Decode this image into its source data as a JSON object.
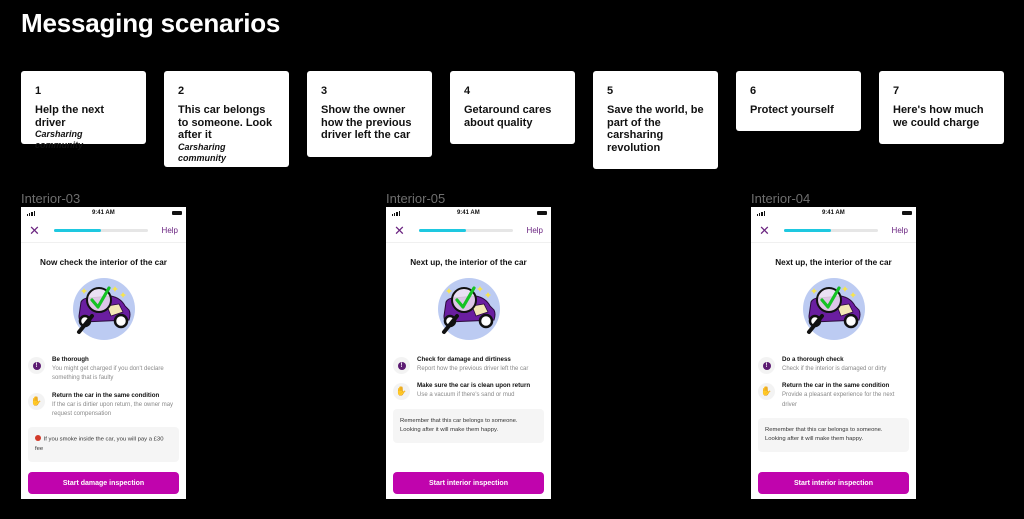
{
  "page": {
    "title": "Messaging scenarios"
  },
  "colors": {
    "background": "#000000",
    "brand_purple": "#6b2480",
    "cta_magenta": "#c004ad",
    "progress_fill": "#1ec8e0"
  },
  "scenarios": [
    {
      "number": "1",
      "text": "Help the next driver",
      "subtitle": "Carsharing community"
    },
    {
      "number": "2",
      "text": "This car belongs to someone. Look after it",
      "subtitle": "Carsharing community"
    },
    {
      "number": "3",
      "text": "Show the owner how the previous driver left the car",
      "subtitle": ""
    },
    {
      "number": "4",
      "text": "Getaround cares about quality",
      "subtitle": ""
    },
    {
      "number": "5",
      "text": "Save the world, be part of the carsharing revolution",
      "subtitle": ""
    },
    {
      "number": "6",
      "text": "Protect yourself",
      "subtitle": ""
    },
    {
      "number": "7",
      "text": "Here's how much we could charge",
      "subtitle": ""
    }
  ],
  "screens": [
    {
      "label": "Interior-03",
      "status_time": "9:41 AM",
      "close_icon": "close-icon",
      "help_label": "Help",
      "progress": 0.5,
      "title": "Now check the interior of the car",
      "illustration": "car-inspection-magnifier-checkmark",
      "tips": [
        {
          "icon": "exclamation-icon",
          "heading": "Be thorough",
          "body": "You might get charged if you don't declare something that is faulty"
        },
        {
          "icon": "hand-icon",
          "heading": "Return the car in the same condition",
          "body": "If the car is dirtier upon return, the owner may request compensation"
        }
      ],
      "note": {
        "icon": "no-smoking-icon",
        "text": "If you smoke inside the car, you will pay a £30 fee"
      },
      "cta_label": "Start damage inspection"
    },
    {
      "label": "Interior-05",
      "status_time": "9:41 AM",
      "close_icon": "close-icon",
      "help_label": "Help",
      "progress": 0.5,
      "title": "Next up, the interior of the car",
      "illustration": "car-inspection-magnifier-checkmark",
      "tips": [
        {
          "icon": "exclamation-icon",
          "heading": "Check for damage and dirtiness",
          "body": "Report how the previous driver left the car"
        },
        {
          "icon": "hand-icon",
          "heading": "Make sure the car is clean upon return",
          "body": "Use a vacuum if there's sand or mud"
        }
      ],
      "note": {
        "icon": "",
        "text": "Remember that this car belongs to someone. Looking after it will make them happy."
      },
      "cta_label": "Start interior inspection"
    },
    {
      "label": "Interior-04",
      "status_time": "9:41 AM",
      "close_icon": "close-icon",
      "help_label": "Help",
      "progress": 0.5,
      "title": "Next up, the interior of the car",
      "illustration": "car-inspection-magnifier-checkmark",
      "tips": [
        {
          "icon": "exclamation-icon",
          "heading": "Do a thorough check",
          "body": "Check if the interior is damaged or dirty"
        },
        {
          "icon": "hand-icon",
          "heading": "Return the car in the same condition",
          "body": "Provide a pleasant experience for the next driver"
        }
      ],
      "note": {
        "icon": "",
        "text": "Remember that this car belongs to someone. Looking after it will make them happy."
      },
      "cta_label": "Start interior inspection"
    }
  ]
}
